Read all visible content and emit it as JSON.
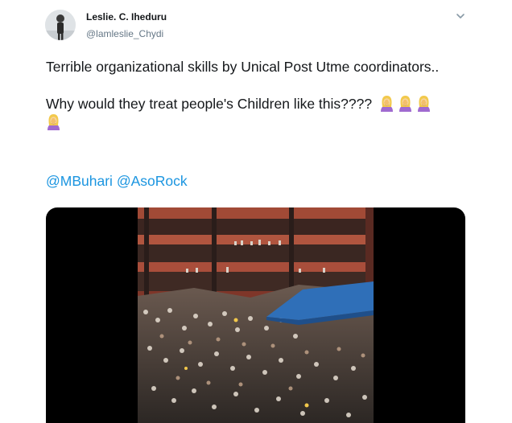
{
  "tweet": {
    "author_name": "Leslie. C. Iheduru",
    "author_handle": "@lamleslie_Chydi",
    "text_line1": "Terrible organizational skills by Unical Post Utme coordinators..",
    "text_line2": "Why would they treat people's Children like this????",
    "emoji_name": "woman-facepalming-icon",
    "mentions": [
      "@MBuhari",
      "@AsoRock"
    ],
    "media_type": "video"
  },
  "colors": {
    "link": "#1b95e0",
    "secondary_text": "#657786",
    "primary_text": "#14171a",
    "media_background": "#000000"
  }
}
